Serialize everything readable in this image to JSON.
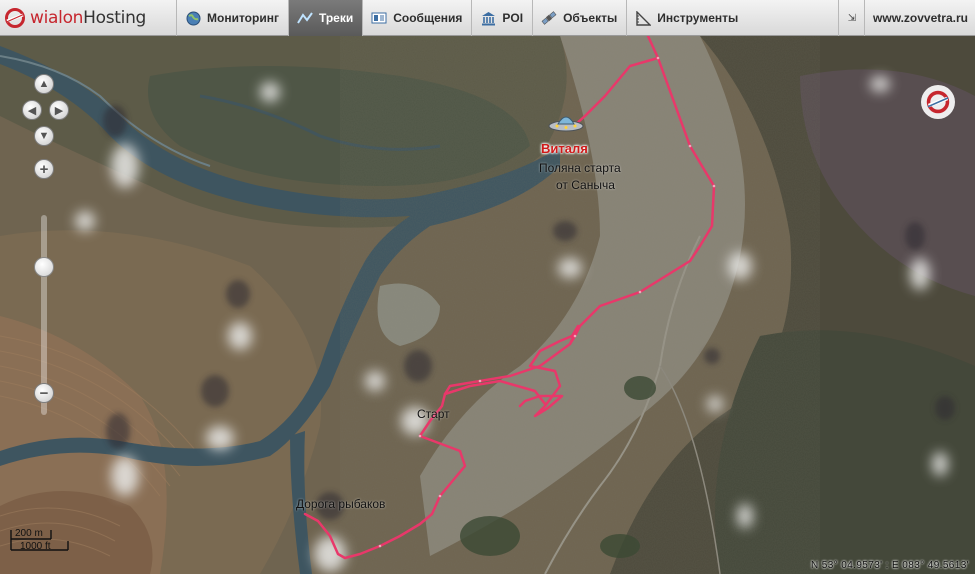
{
  "app": {
    "logo_text_a": "wialon",
    "logo_text_b": "Hosting"
  },
  "nav": [
    {
      "key": "monitoring",
      "label": "Мониторинг",
      "icon": "globe-icon",
      "active": false
    },
    {
      "key": "tracks",
      "label": "Треки",
      "icon": "track-icon",
      "active": true
    },
    {
      "key": "messages",
      "label": "Сообщения",
      "icon": "messages-icon",
      "active": false
    },
    {
      "key": "poi",
      "label": "POI",
      "icon": "poi-icon",
      "active": false
    },
    {
      "key": "objects",
      "label": "Объекты",
      "icon": "satellite-icon",
      "active": false
    },
    {
      "key": "tools",
      "label": "Инструменты",
      "icon": "ruler-icon",
      "active": false
    }
  ],
  "header": {
    "site": "www.zovvetra.ru",
    "expand_icon": "expand-icon"
  },
  "map": {
    "unit_name": "Виталя",
    "unit_icon": "ufo-icon",
    "labels": {
      "polyana_line1": "Поляна старта",
      "polyana_line2": "от Саныча",
      "start": "Старт",
      "road": "Дорога рыбаков"
    },
    "scale": {
      "metric": "200 m",
      "imperial": "1000 ft"
    },
    "coordinates": "N 53° 04.9573' : E 083° 49.5613'",
    "track_color": "#e8386a",
    "corner_logo_icon": "wialon-logo-icon"
  }
}
